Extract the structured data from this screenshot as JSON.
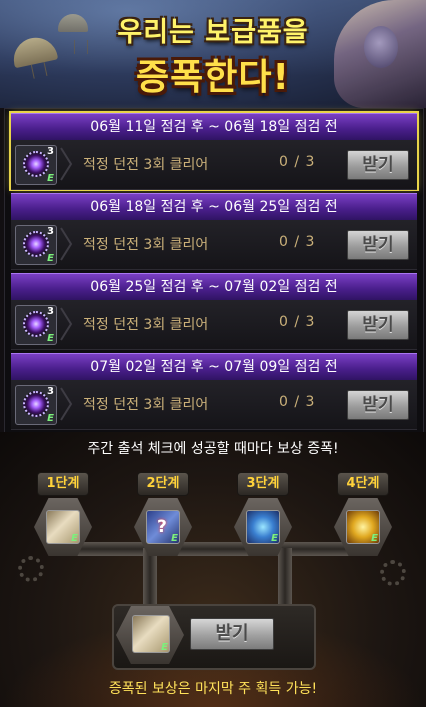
{
  "banner": {
    "title_line1": "우리는 보급품을",
    "title_line2": "증폭한다!"
  },
  "quests": [
    {
      "period": "06월 11일 점검 후 ~ 06월 18일 점검 전",
      "mission": "적정 던전 3회 클리어",
      "progress": "0 / 3",
      "button": "받기",
      "item_qty": "3",
      "item_grade": "E",
      "active": true
    },
    {
      "period": "06월 18일 점검 후 ~ 06월 25일 점검 전",
      "mission": "적정 던전 3회 클리어",
      "progress": "0 / 3",
      "button": "받기",
      "item_qty": "3",
      "item_grade": "E",
      "active": false
    },
    {
      "period": "06월 25일 점검 후 ~ 07월 02일 점검 전",
      "mission": "적정 던전 3회 클리어",
      "progress": "0 / 3",
      "button": "받기",
      "item_qty": "3",
      "item_grade": "E",
      "active": false
    },
    {
      "period": "07월 02일 점검 후 ~ 07월 09일 점검 전",
      "mission": "적정 던전 3회 클리어",
      "progress": "0 / 3",
      "button": "받기",
      "item_qty": "3",
      "item_grade": "E",
      "active": false
    }
  ],
  "attendance_text": "주간 출석 체크에 성공할 때마다 보상 증폭!",
  "steps": [
    {
      "label": "1단계",
      "icon": "scroll-icon",
      "grade": "E"
    },
    {
      "label": "2단계",
      "icon": "mystery-box-icon",
      "grade": "E"
    },
    {
      "label": "3단계",
      "icon": "blue-orb-icon",
      "grade": "E"
    },
    {
      "label": "4단계",
      "icon": "gold-emblem-icon",
      "grade": "E"
    }
  ],
  "final_reward": {
    "button": "받기",
    "icon": "scroll-icon",
    "grade": "E"
  },
  "footer_note": "증폭된 보상은 마지막 주 획득 가능!",
  "colors": {
    "header_purple": "#4a1f8c",
    "active_outline": "#e8d44a",
    "step_label": "#ffd23a",
    "footer_text": "#ffe25a"
  }
}
